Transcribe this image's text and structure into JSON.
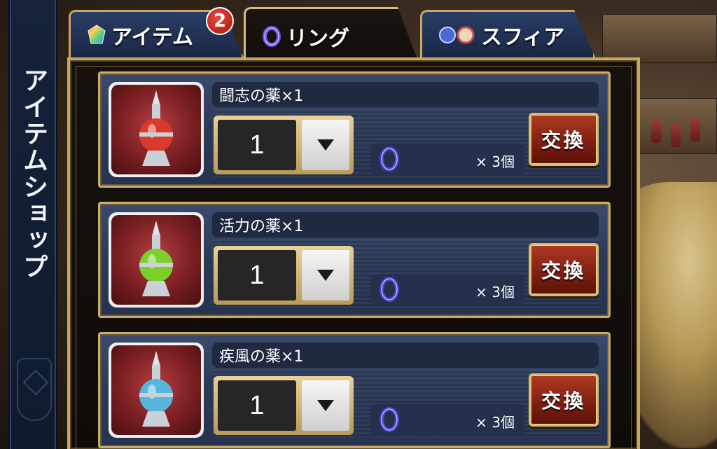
{
  "sidebar": {
    "title": "アイテムショップ"
  },
  "tabs": [
    {
      "label": "アイテム",
      "icon": "rainbow-crystal-icon",
      "badge": "2",
      "active": false
    },
    {
      "label": "リング",
      "icon": "ring-icon",
      "active": true
    },
    {
      "label": "スフィア",
      "icon": "sphere-icon",
      "active": false
    }
  ],
  "items": [
    {
      "name": "闘志の薬×1",
      "quantity": "1",
      "cost": "× 3個",
      "button": "交換",
      "potion_color": "#d93a2a"
    },
    {
      "name": "活力の薬×1",
      "quantity": "1",
      "cost": "× 3個",
      "button": "交換",
      "potion_color": "#7ccf2a"
    },
    {
      "name": "疾風の薬×1",
      "quantity": "1",
      "cost": "× 3個",
      "button": "交換",
      "potion_color": "#58b6de"
    }
  ],
  "colors": {
    "gold": "#c8a860",
    "panel_blue": "#2c3a58",
    "exchange_red": "#9a2a18"
  }
}
